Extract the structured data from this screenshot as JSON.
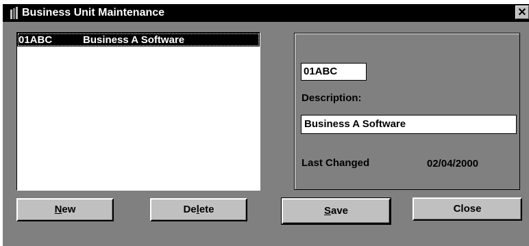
{
  "window": {
    "title": "Business Unit Maintenance",
    "close_glyph": "✕",
    "icon": "books-icon"
  },
  "list": {
    "rows": [
      {
        "code": "01ABC",
        "description": "Business A Software",
        "selected": true
      }
    ]
  },
  "details": {
    "code_value": "01ABC",
    "description_label": "Description:",
    "description_value": "Business A Software",
    "last_changed_label": "Last Changed",
    "last_changed_value": "02/04/2000"
  },
  "buttons": {
    "new": {
      "pre": "",
      "accel": "N",
      "post": "ew"
    },
    "delete": {
      "pre": "De",
      "accel": "l",
      "post": "ete"
    },
    "save": {
      "pre": "",
      "accel": "S",
      "post": "ave"
    },
    "close": "Close"
  },
  "colors": {
    "titlebar": "#000000",
    "client": "#808080",
    "button": "#c0c0c0",
    "selection": "#000000"
  }
}
